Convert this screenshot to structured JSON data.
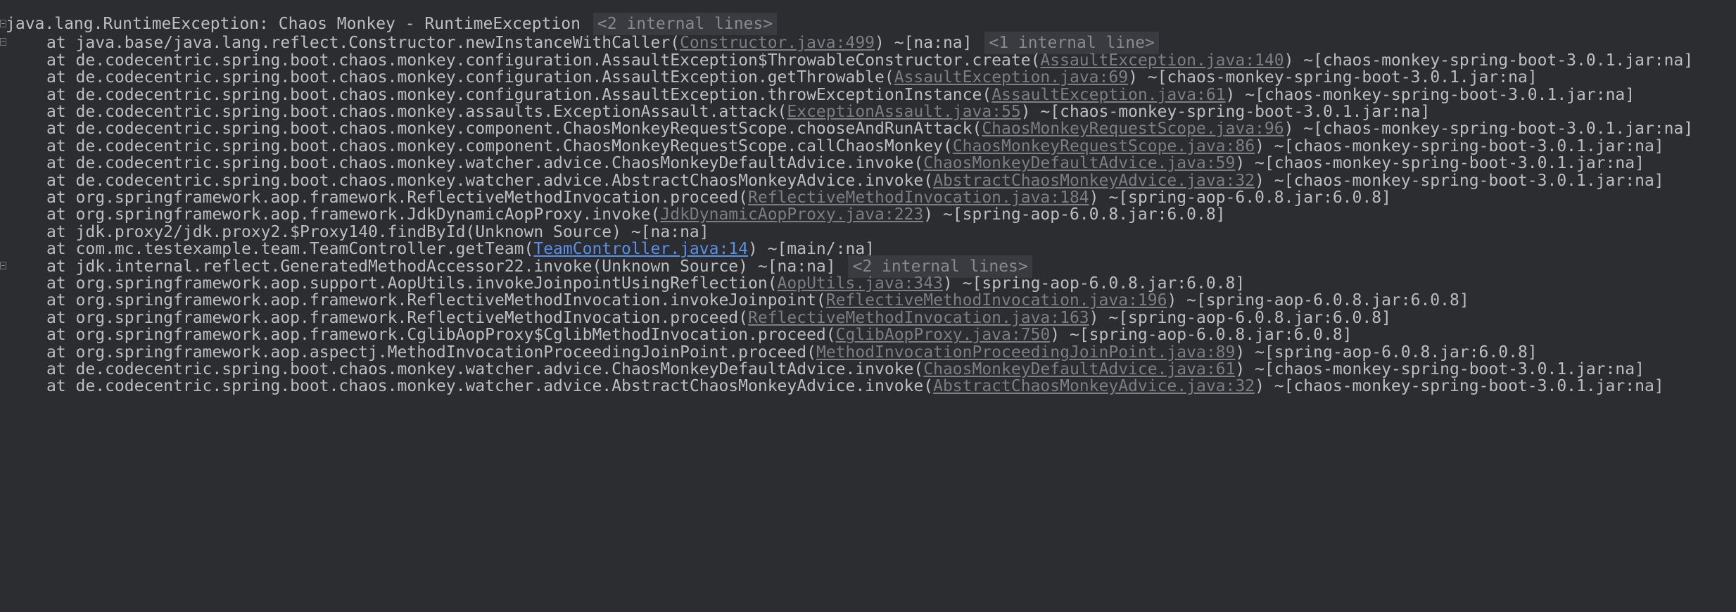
{
  "header": {
    "text": "java.lang.RuntimeException: Chaos Monkey - RuntimeException",
    "folded": "<2 internal lines>"
  },
  "frames": [
    {
      "prefix": "at java.base/java.lang.reflect.Constructor.newInstanceWithCaller(",
      "link": "Constructor.java:499",
      "suffix": ") ~[na:na]",
      "folded": "<1 internal line>",
      "foldable": true
    },
    {
      "prefix": "at de.codecentric.spring.boot.chaos.monkey.configuration.AssaultException$ThrowableConstructor.create(",
      "link": "AssaultException.java:140",
      "suffix": ") ~[chaos-monkey-spring-boot-3.0.1.jar:na]"
    },
    {
      "prefix": "at de.codecentric.spring.boot.chaos.monkey.configuration.AssaultException.getThrowable(",
      "link": "AssaultException.java:69",
      "suffix": ") ~[chaos-monkey-spring-boot-3.0.1.jar:na]"
    },
    {
      "prefix": "at de.codecentric.spring.boot.chaos.monkey.configuration.AssaultException.throwExceptionInstance(",
      "link": "AssaultException.java:61",
      "suffix": ") ~[chaos-monkey-spring-boot-3.0.1.jar:na]"
    },
    {
      "prefix": "at de.codecentric.spring.boot.chaos.monkey.assaults.ExceptionAssault.attack(",
      "link": "ExceptionAssault.java:55",
      "suffix": ") ~[chaos-monkey-spring-boot-3.0.1.jar:na]"
    },
    {
      "prefix": "at de.codecentric.spring.boot.chaos.monkey.component.ChaosMonkeyRequestScope.chooseAndRunAttack(",
      "link": "ChaosMonkeyRequestScope.java:96",
      "suffix": ") ~[chaos-monkey-spring-boot-3.0.1.jar:na]"
    },
    {
      "prefix": "at de.codecentric.spring.boot.chaos.monkey.component.ChaosMonkeyRequestScope.callChaosMonkey(",
      "link": "ChaosMonkeyRequestScope.java:86",
      "suffix": ") ~[chaos-monkey-spring-boot-3.0.1.jar:na]"
    },
    {
      "prefix": "at de.codecentric.spring.boot.chaos.monkey.watcher.advice.ChaosMonkeyDefaultAdvice.invoke(",
      "link": "ChaosMonkeyDefaultAdvice.java:59",
      "suffix": ") ~[chaos-monkey-spring-boot-3.0.1.jar:na]"
    },
    {
      "prefix": "at de.codecentric.spring.boot.chaos.monkey.watcher.advice.AbstractChaosMonkeyAdvice.invoke(",
      "link": "AbstractChaosMonkeyAdvice.java:32",
      "suffix": ") ~[chaos-monkey-spring-boot-3.0.1.jar:na]"
    },
    {
      "prefix": "at org.springframework.aop.framework.ReflectiveMethodInvocation.proceed(",
      "link": "ReflectiveMethodInvocation.java:184",
      "suffix": ") ~[spring-aop-6.0.8.jar:6.0.8]"
    },
    {
      "prefix": "at org.springframework.aop.framework.JdkDynamicAopProxy.invoke(",
      "link": "JdkDynamicAopProxy.java:223",
      "suffix": ") ~[spring-aop-6.0.8.jar:6.0.8]"
    },
    {
      "prefix": "at jdk.proxy2/jdk.proxy2.$Proxy140.findById(Unknown Source) ~[na:na]"
    },
    {
      "prefix": "at com.mc.testexample.team.TeamController.getTeam(",
      "link": "TeamController.java:14",
      "suffix": ") ~[main/:na]",
      "active": true
    },
    {
      "prefix": "at jdk.internal.reflect.GeneratedMethodAccessor22.invoke(Unknown Source) ~[na:na]",
      "folded": "<2 internal lines>",
      "foldable": true
    },
    {
      "prefix": "at org.springframework.aop.support.AopUtils.invokeJoinpointUsingReflection(",
      "link": "AopUtils.java:343",
      "suffix": ") ~[spring-aop-6.0.8.jar:6.0.8]"
    },
    {
      "prefix": "at org.springframework.aop.framework.ReflectiveMethodInvocation.invokeJoinpoint(",
      "link": "ReflectiveMethodInvocation.java:196",
      "suffix": ") ~[spring-aop-6.0.8.jar:6.0.8]"
    },
    {
      "prefix": "at org.springframework.aop.framework.ReflectiveMethodInvocation.proceed(",
      "link": "ReflectiveMethodInvocation.java:163",
      "suffix": ") ~[spring-aop-6.0.8.jar:6.0.8]"
    },
    {
      "prefix": "at org.springframework.aop.framework.CglibAopProxy$CglibMethodInvocation.proceed(",
      "link": "CglibAopProxy.java:750",
      "suffix": ") ~[spring-aop-6.0.8.jar:6.0.8]"
    },
    {
      "prefix": "at org.springframework.aop.aspectj.MethodInvocationProceedingJoinPoint.proceed(",
      "link": "MethodInvocationProceedingJoinPoint.java:89",
      "suffix": ") ~[spring-aop-6.0.8.jar:6.0.8]"
    },
    {
      "prefix": "at de.codecentric.spring.boot.chaos.monkey.watcher.advice.ChaosMonkeyDefaultAdvice.invoke(",
      "link": "ChaosMonkeyDefaultAdvice.java:61",
      "suffix": ") ~[chaos-monkey-spring-boot-3.0.1.jar:na]"
    },
    {
      "prefix": "at de.codecentric.spring.boot.chaos.monkey.watcher.advice.AbstractChaosMonkeyAdvice.invoke(",
      "link": "AbstractChaosMonkeyAdvice.java:32",
      "suffix": ") ~[chaos-monkey-spring-boot-3.0.1.jar:na]"
    }
  ],
  "colors": {
    "background": "#2b2d30",
    "text": "#bcbec4",
    "link": "#7a7e85",
    "active_link": "#5c8fe6",
    "folded_background": "#393b40"
  },
  "icons": {
    "fold": "fold-toggle-icon"
  }
}
